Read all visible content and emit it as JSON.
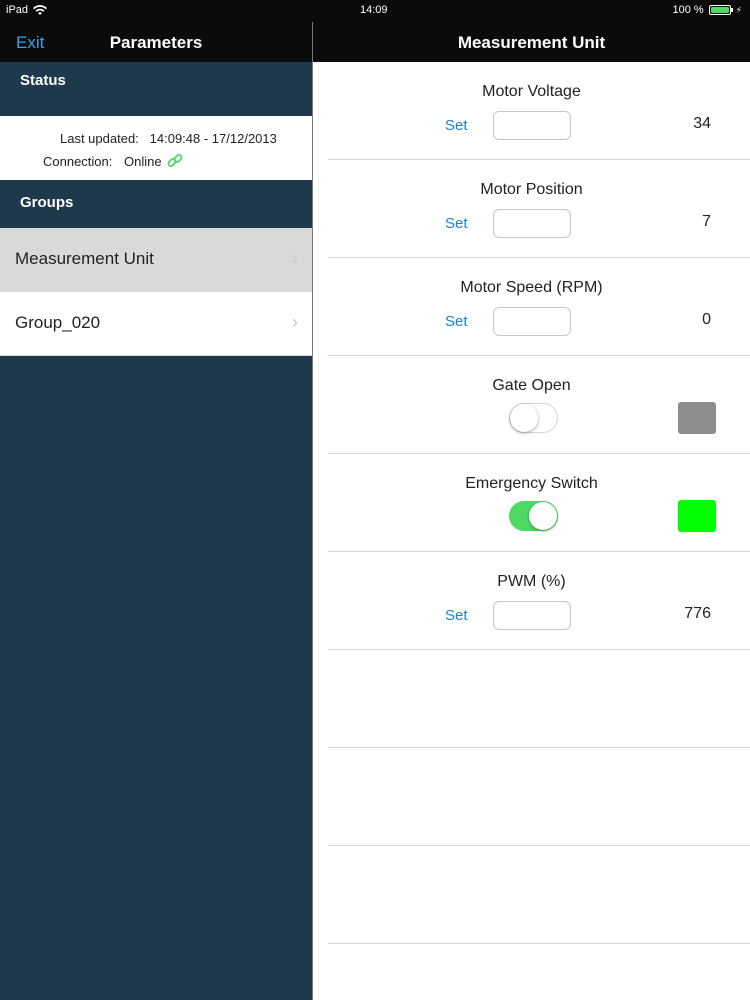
{
  "statusbar": {
    "device": "iPad",
    "time": "14:09",
    "battery": "100 %"
  },
  "left": {
    "exit_label": "Exit",
    "title": "Parameters",
    "status_header": "Status",
    "last_updated_label": "Last updated:",
    "last_updated_value": "14:09:48 - 17/12/2013",
    "connection_label": "Connection:",
    "connection_value": "Online",
    "groups_header": "Groups",
    "groups": [
      {
        "label": "Measurement Unit",
        "selected": true
      },
      {
        "label": "Group_020",
        "selected": false
      }
    ]
  },
  "right": {
    "title": "Measurement Unit",
    "set_label": "Set",
    "params": [
      {
        "label": "Motor Voltage",
        "type": "input",
        "value": "34"
      },
      {
        "label": "Motor Position",
        "type": "input",
        "value": "7"
      },
      {
        "label": "Motor Speed (RPM)",
        "type": "input",
        "value": "0"
      },
      {
        "label": "Gate Open",
        "type": "toggle",
        "on": false,
        "indicator_color": "#8e8e90"
      },
      {
        "label": "Emergency Switch",
        "type": "toggle",
        "on": true,
        "indicator_color": "#00ff00"
      },
      {
        "label": "PWM (%)",
        "type": "input",
        "value": "776"
      }
    ]
  },
  "colors": {
    "accent": "#36a4e8",
    "sidebar_bg": "#1d394b",
    "toggle_on": "#4cd964"
  }
}
